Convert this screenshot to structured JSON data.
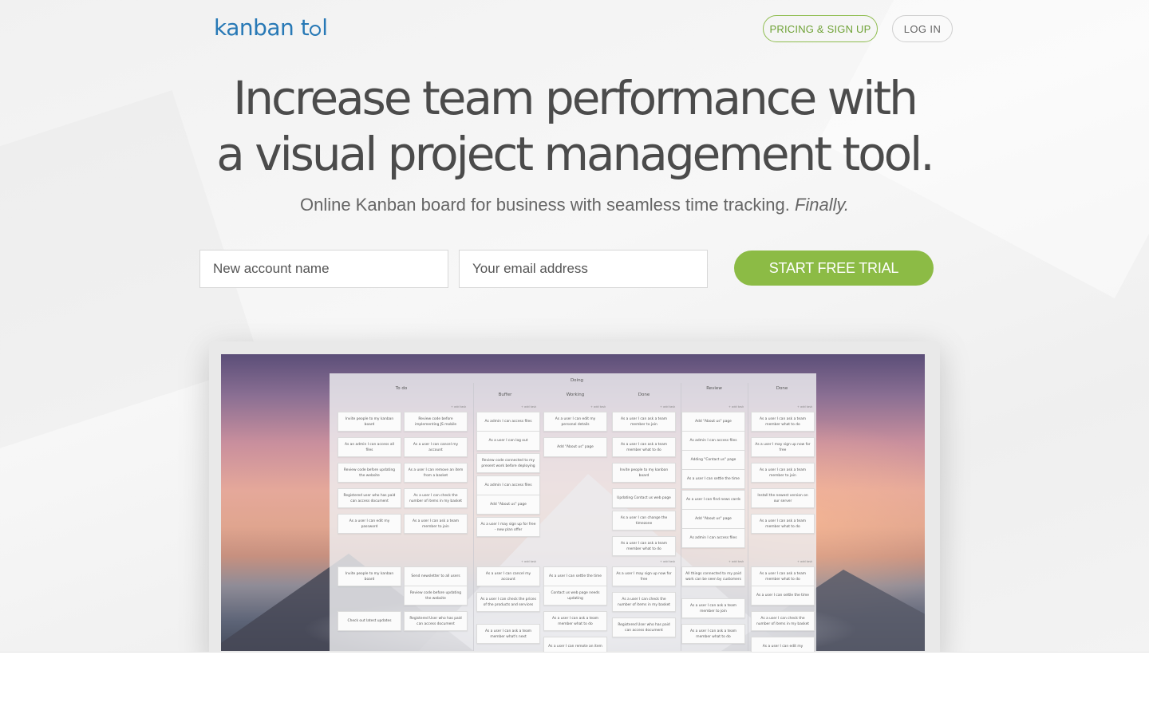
{
  "header": {
    "logo_part1": "kanban t",
    "logo_part2": "l",
    "pricing_label": "PRICING & SIGN UP",
    "login_label": "LOG IN"
  },
  "hero": {
    "headline_line1": "Increase team performance with",
    "headline_line2": "a visual project management tool.",
    "subtitle": "Online Kanban board for business with seamless time tracking.",
    "subtitle_emphasis": "Finally."
  },
  "signup": {
    "account_placeholder": "New account name",
    "email_placeholder": "Your email address",
    "cta_label": "START FREE TRIAL"
  },
  "board": {
    "headers": {
      "todo": "To do",
      "doing": "Doing",
      "buffer": "Buffer",
      "working": "Working",
      "done_doing": "Done",
      "review": "Review",
      "done": "Done"
    },
    "add_task": "+ add task",
    "cards": [
      "Invite people to my kanban board",
      "Review code before implementing JS mobile",
      "As an admin I can access all files",
      "As a user I can cancel my account",
      "Review code before updating the website",
      "As a user I can remove an item from a basket",
      "Registered user who has paid can access document",
      "As a user I can check the number of items in my basket",
      "As a user I can edit my password",
      "As a user I can ask a team member to join",
      "As admin I can access files",
      "As a user I can log out",
      "Review code connected to my present work before deploying",
      "As admin I can access files",
      "Add \"About us\" page",
      "As a user I may sign up for free - new plan offer",
      "As a user I can edit my personal details",
      "Add \"About us\" page",
      "As a user I can ask a team member to join",
      "As a user I can ask a team member what to do",
      "Invite people to my kanban board",
      "Updating Contact us web page",
      "As a user I can change the timezone",
      "As a user I can ask a team member what to do",
      "Add \"About us\" page",
      "As admin I can access files",
      "Adding \"Contact us\" page",
      "As a user I can settle the time",
      "As a user I can find news cards",
      "Add \"About us\" page",
      "As admin I can access files",
      "As a user I can ask a team member what to do",
      "As a user I may sign up now for free",
      "As a user I can ask a team member to join",
      "Install the newest version on our server",
      "As a user I can ask a team member what to do",
      "Invite people to my kanban board",
      "Send newsletter to all users",
      "Review code before updating the website",
      "Check out latest updates",
      "Registered User who has paid can access document",
      "As a user I can cancel my account",
      "As a user I can check the prices of the products and services",
      "As a user I can ask a team member what's next",
      "As a user I can settle the time",
      "Contact us web page needs updating",
      "As a user I can ask a team member what to do",
      "As a user I can remote an item",
      "As a user I may sign up now for free",
      "As a user I can check the number of items in my basket",
      "Registered User who has paid can access document",
      "All things connected to my paid work can be seen by customers",
      "As a user I can ask a team member to join",
      "As a user I can ask a team member what to do",
      "As a user I can ask a team member what to do",
      "As a user I can settle the time",
      "As a user I can check the number of items in my basket",
      "As a user I can edit my"
    ]
  }
}
